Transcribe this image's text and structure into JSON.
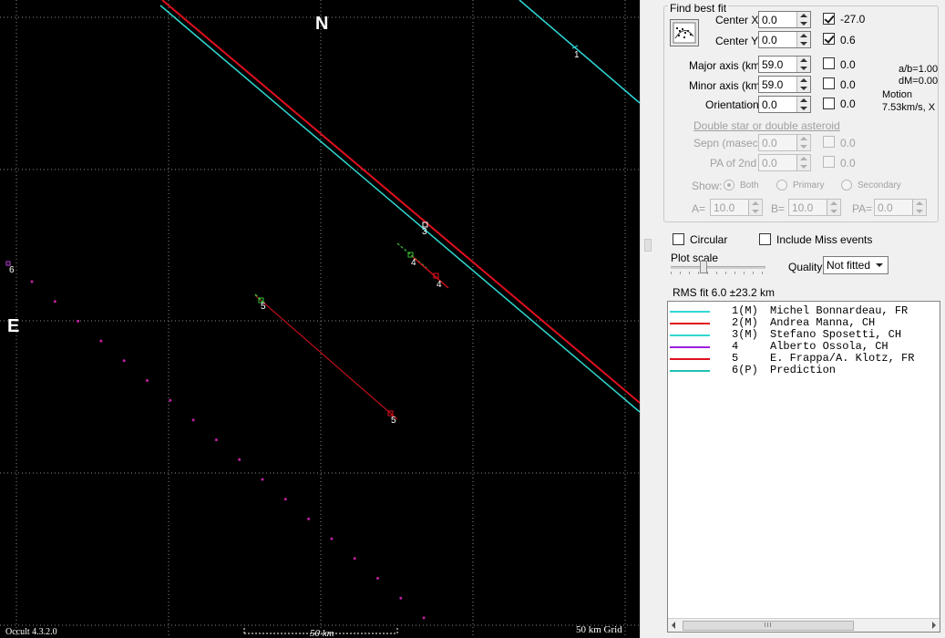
{
  "plot": {
    "north_label": "N",
    "east_label": "E",
    "version": "Occult 4.3.2.0",
    "scale_label": "50 km",
    "grid_label": "50 km Grid",
    "chord_labels": [
      "1",
      "3",
      "4",
      "4",
      "5",
      "5",
      "6"
    ],
    "colors": {
      "background": "#000000",
      "grid": "#8a8a8a",
      "red_chord": "#e0101e",
      "cyan_chord": "#30d8d0",
      "green_chord": "#38c038",
      "miss_dots": "#c020a0",
      "labels": "#ffffff"
    }
  },
  "panel": {
    "find_best_fit": {
      "title": "Find best fit",
      "button_icon": "fit-curve-icon",
      "center_x_label": "Center X",
      "center_x_value": "0.0",
      "center_x_checked": true,
      "center_x_result": "-27.0",
      "center_y_label": "Center Y",
      "center_y_value": "0.0",
      "center_y_checked": true,
      "center_y_result": "0.6",
      "major_axis_label": "Major axis (km)",
      "major_axis_value": "59.0",
      "major_axis_checked": false,
      "major_axis_result": "0.0",
      "minor_axis_label": "Minor axis (km)",
      "minor_axis_value": "59.0",
      "minor_axis_checked": false,
      "minor_axis_result": "0.0",
      "orientation_label": "Orientation",
      "orientation_value": "0.0",
      "orientation_checked": false,
      "orientation_result": "0.0",
      "ab_ratio": "a/b=1.00",
      "dm": "dM=0.00",
      "motion_label": "Motion",
      "motion_value": "7.53km/s, X",
      "double_title": "Double star  or  double asteroid",
      "sepn_label": "Sepn (masec)",
      "sepn_value": "0.0",
      "sepn_result": "0.0",
      "pa2_label": "PA of 2nd",
      "pa2_value": "0.0",
      "pa2_result": "0.0",
      "show_label": "Show:",
      "show_options": [
        "Both",
        "Primary",
        "Secondary"
      ],
      "a_label": "A=",
      "a_value": "10.0",
      "b_label": "B=",
      "b_value": "10.0",
      "pa_label": "PA=",
      "pa_value": "0.0"
    },
    "circular_label": "Circular",
    "include_miss_label": "Include Miss events",
    "plot_scale_label": "Plot scale",
    "quality_label": "Quality",
    "quality_value": "Not fitted",
    "rms_fit": "RMS fit 6.0 ±23.2 km",
    "observers": [
      {
        "num": "1(M)",
        "name": "Michel Bonnardeau, FR",
        "color": "#30d8d8"
      },
      {
        "num": "2(M)",
        "name": "Andrea Manna, CH",
        "color": "#e0101e"
      },
      {
        "num": "3(M)",
        "name": "Stefano Sposetti, CH",
        "color": "#30d8d0"
      },
      {
        "num": "4",
        "name": "Alberto Ossola, CH",
        "color": "#a020e0"
      },
      {
        "num": "5",
        "name": "E. Frappa/A. Klotz, FR",
        "color": "#e0101e"
      },
      {
        "num": "6(P)",
        "name": "Prediction",
        "color": "#20c0b0"
      }
    ]
  }
}
